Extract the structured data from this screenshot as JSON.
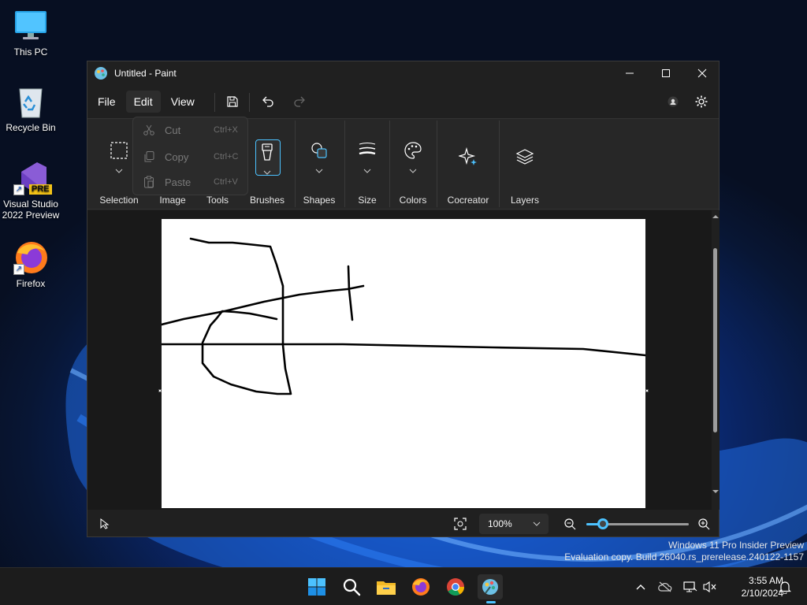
{
  "desktop": {
    "icons": [
      {
        "label": "This PC"
      },
      {
        "label": "Recycle Bin"
      },
      {
        "label": "Visual Studio 2022 Preview",
        "badge": "PRE"
      },
      {
        "label": "Firefox"
      }
    ]
  },
  "window": {
    "title": "Untitled - Paint",
    "menu": {
      "file": "File",
      "edit": "Edit",
      "view": "View"
    },
    "ribbon": {
      "groups": [
        "Selection",
        "Image",
        "Tools",
        "Brushes",
        "Shapes",
        "Size",
        "Colors",
        "Cocreator",
        "Layers"
      ]
    },
    "edit_menu": {
      "items": [
        {
          "label": "Cut",
          "shortcut": "Ctrl+X",
          "enabled": false
        },
        {
          "label": "Copy",
          "shortcut": "Ctrl+C",
          "enabled": false
        },
        {
          "label": "Paste",
          "shortcut": "Ctrl+V",
          "enabled": false
        }
      ]
    },
    "status": {
      "zoom_value": "100%",
      "zoom_slider_percent": 16
    },
    "colors": {
      "accent": "#4cc2ff",
      "window_bg": "#202020",
      "ribbon_bg": "#272727",
      "canvas_bg": "#ffffff"
    }
  },
  "watermark": {
    "line1": "Windows 11 Pro Insider Preview",
    "line2": "Evaluation copy. Build 26040.rs_prerelease.240122-1157"
  },
  "taskbar": {
    "apps": [
      "start-icon",
      "search-icon",
      "file-explorer-icon",
      "firefox-icon",
      "chrome-icon",
      "paint-icon"
    ],
    "clock": {
      "time": "3:55 AM",
      "date": "2/10/2024"
    }
  }
}
